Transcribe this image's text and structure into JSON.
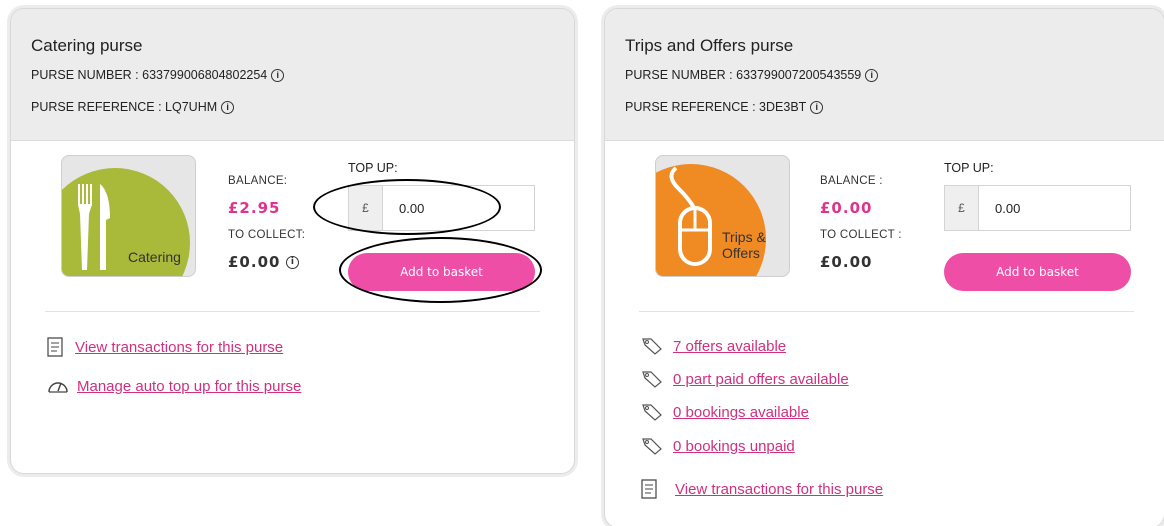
{
  "catering": {
    "title": "Catering purse",
    "purse_number": "PURSE NUMBER : 633799006804802254",
    "purse_reference": "PURSE REFERENCE : LQ7UHM",
    "logo_text": "Catering",
    "balance_label": "BALANCE:",
    "balance_value": "£2.95",
    "to_collect_label": "TO COLLECT:",
    "to_collect_value": "£0.00",
    "topup_label": "TOP UP:",
    "currency": "£",
    "topup_value": "0.00",
    "add_button": "Add to basket",
    "links": [
      {
        "label": "View transactions for this purse",
        "icon": "receipt-icon"
      },
      {
        "label": "Manage auto top up for this purse",
        "icon": "gauge-icon"
      }
    ]
  },
  "trips": {
    "title": "Trips and Offers purse",
    "purse_number": "PURSE NUMBER : 633799007200543559",
    "purse_reference": "PURSE REFERENCE : 3DE3BT",
    "logo_text_1": "Trips &",
    "logo_text_2": "Offers",
    "balance_label": "BALANCE :",
    "balance_value": "£0.00",
    "to_collect_label": "TO COLLECT :",
    "to_collect_value": "£0.00",
    "topup_label": "TOP UP:",
    "currency": "£",
    "topup_value": "0.00",
    "add_button": "Add to basket",
    "links": [
      {
        "label": "7 offers available",
        "icon": "tag-icon"
      },
      {
        "label": "0 part paid offers available",
        "icon": "tag-icon"
      },
      {
        "label": "0 bookings available",
        "icon": "tag-icon"
      },
      {
        "label": "0 bookings unpaid",
        "icon": "tag-icon"
      },
      {
        "label": "View transactions for this purse",
        "icon": "receipt-icon"
      }
    ]
  },
  "colors": {
    "accent_pink": "#ee4ea6",
    "link_pink": "#d0307f",
    "catering_green": "#a9b93a",
    "trips_orange": "#f08a22"
  }
}
